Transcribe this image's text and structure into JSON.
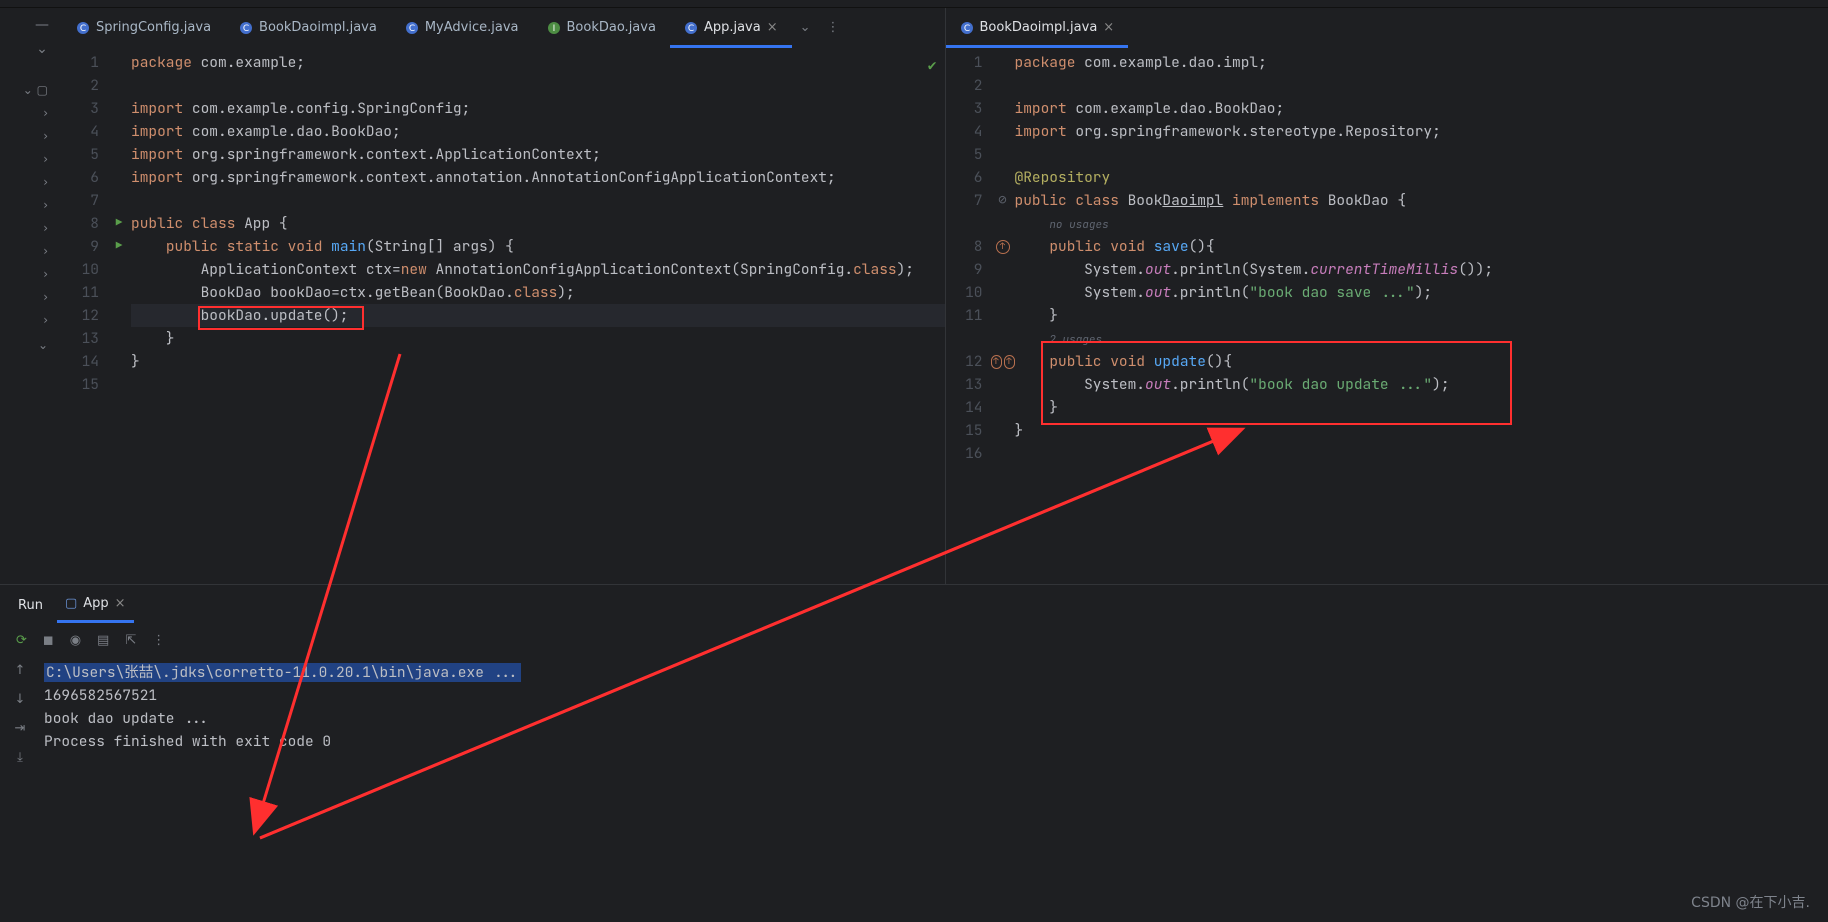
{
  "tabs_left": [
    {
      "label": "SpringConfig.java",
      "kind": "class"
    },
    {
      "label": "BookDaoimpl.java",
      "kind": "class"
    },
    {
      "label": "MyAdvice.java",
      "kind": "class"
    },
    {
      "label": "BookDao.java",
      "kind": "iface"
    },
    {
      "label": "App.java",
      "kind": "class",
      "active": true
    }
  ],
  "tabs_right": [
    {
      "label": "BookDaoimpl.java",
      "kind": "class",
      "active": true
    }
  ],
  "left_code": {
    "lines": [
      "package com.example;",
      "",
      "import com.example.config.SpringConfig;",
      "import com.example.dao.BookDao;",
      "import org.springframework.context.ApplicationContext;",
      "import org.springframework.context.annotation.AnnotationConfigApplicationContext;",
      "",
      "public class App {",
      "    public static void main(String[] args) {",
      "        ApplicationContext ctx=new AnnotationConfigApplicationContext(SpringConfig.class);",
      "        BookDao bookDao=ctx.getBean(BookDao.class);",
      "        bookDao.update();",
      "    }",
      "}",
      ""
    ]
  },
  "right_code": {
    "lines": [
      "package com.example.dao.impl;",
      "",
      "import com.example.dao.BookDao;",
      "import org.springframework.stereotype.Repository;",
      "",
      "@Repository",
      "public class BookDaoimpl implements BookDao {",
      "no usages",
      "    public void save(){",
      "        System.out.println(System.currentTimeMillis());",
      "        System.out.println(\"book dao save ...\");",
      "    }",
      "2 usages",
      "    public void update(){",
      "        System.out.println(\"book dao update ...\");",
      "    }",
      "}",
      ""
    ],
    "line_nums": [
      "1",
      "2",
      "3",
      "4",
      "5",
      "6",
      "7",
      "",
      "8",
      "9",
      "10",
      "11",
      "",
      "12",
      "13",
      "14",
      "15",
      "16"
    ]
  },
  "run": {
    "label": "Run",
    "tab": "App",
    "lines": [
      "C:\\Users\\张喆\\.jdks\\corretto-11.0.20.1\\bin\\java.exe ...",
      "1696582567521",
      "book dao update ...",
      "",
      "Process finished with exit code 0"
    ]
  },
  "watermark": "CSDN @在下小吉."
}
